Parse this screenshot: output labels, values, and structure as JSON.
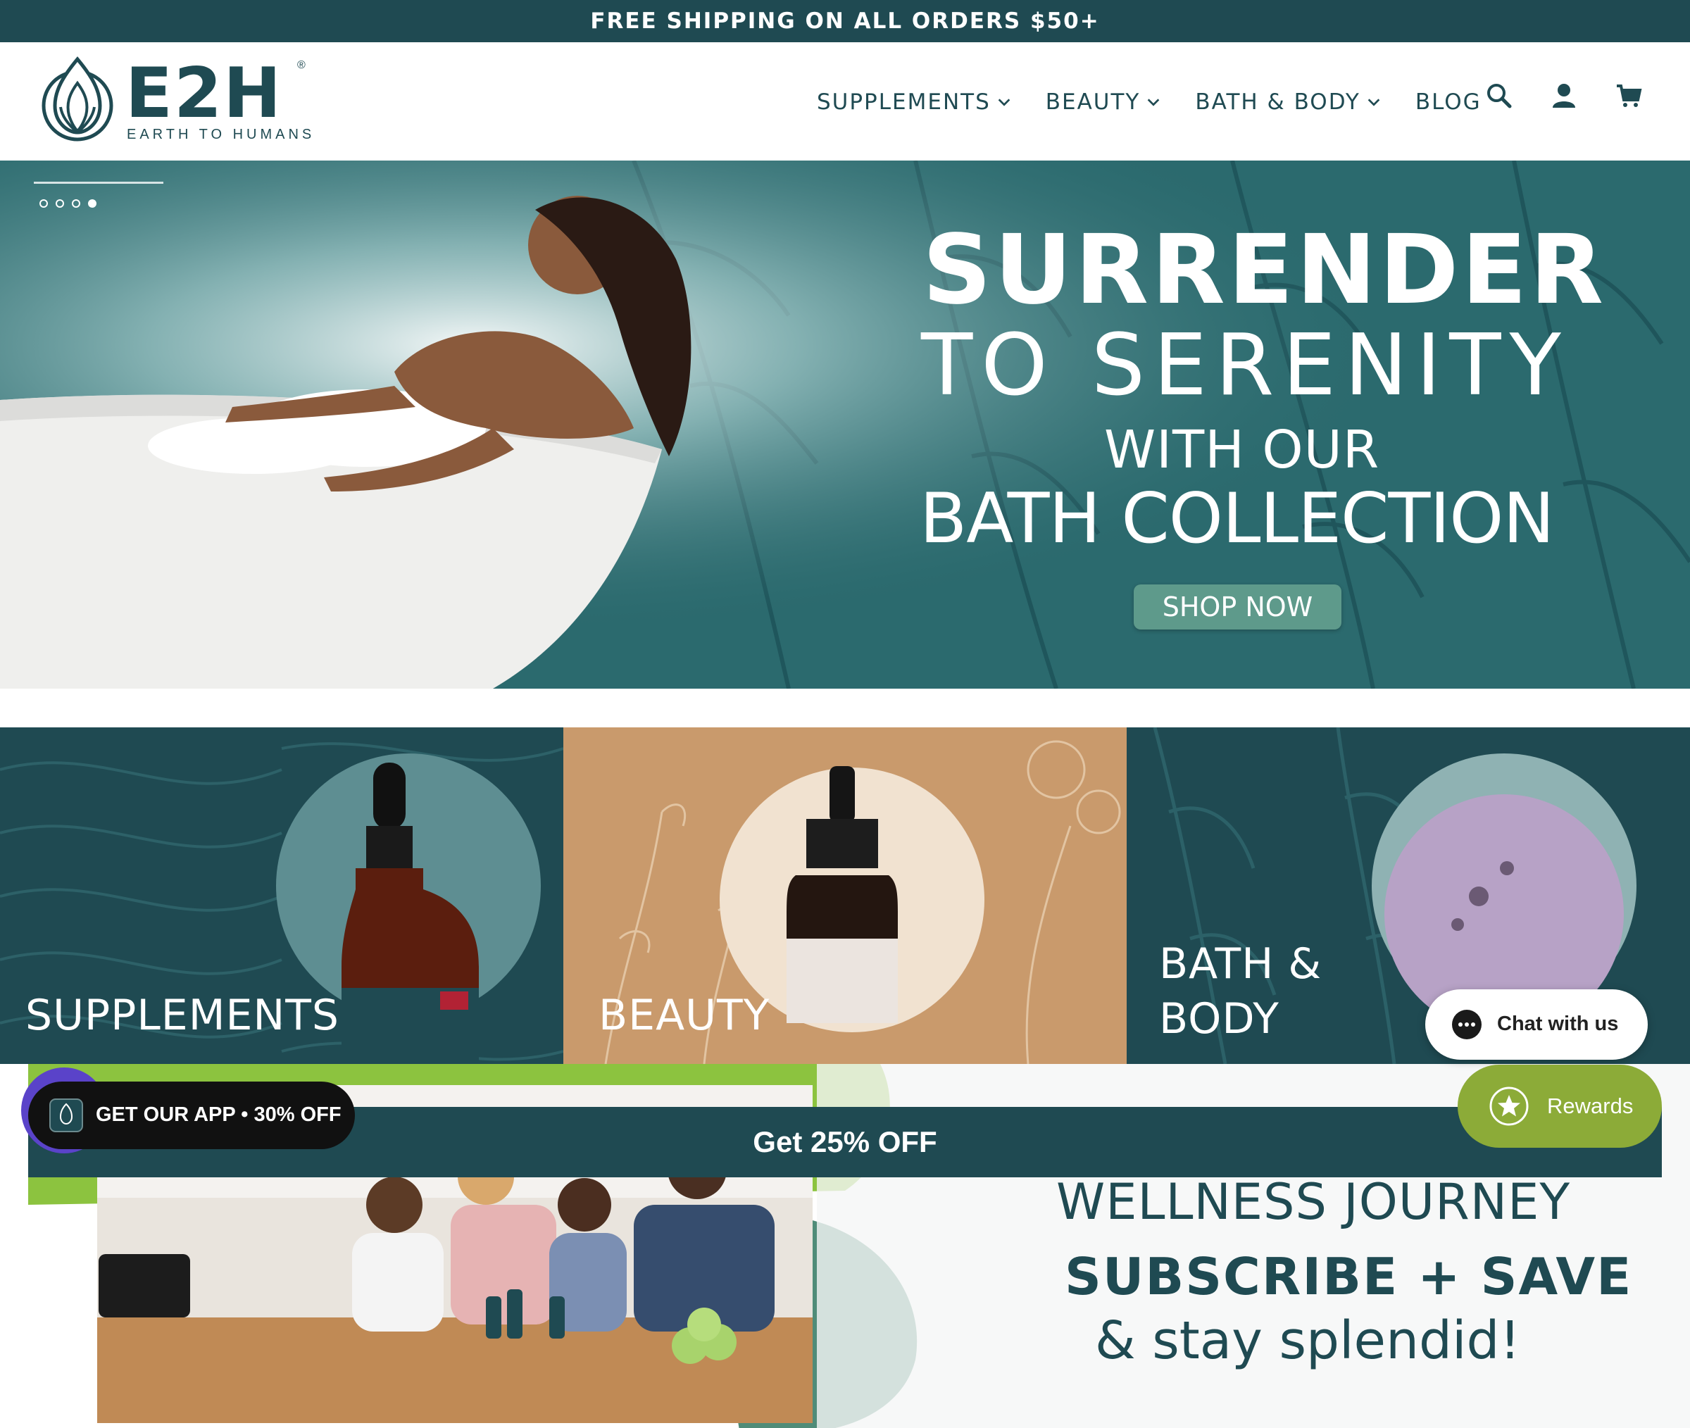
{
  "announcement": "FREE SHIPPING ON ALL ORDERS $50+",
  "brand": {
    "name": "E2H",
    "tagline": "EARTH TO HUMANS",
    "reg": "®"
  },
  "nav": {
    "items": [
      "SUPPLEMENTS",
      "BEAUTY",
      "BATH & BODY",
      "BLOG"
    ],
    "icons": [
      "search-icon",
      "account-icon",
      "cart-icon"
    ]
  },
  "hero": {
    "line1": "SURRENDER",
    "line2": "TO SERENITY",
    "line3": "WITH OUR",
    "line4": "BATH COLLECTION",
    "cta": "SHOP NOW",
    "slides": 4,
    "active_slide": 4
  },
  "categories": [
    {
      "label_1": "SUPPLEMENTS",
      "label_2": ""
    },
    {
      "label_1": "BEAUTY",
      "label_2": ""
    },
    {
      "label_1": "BATH &",
      "label_2": "BODY"
    }
  ],
  "promo": {
    "bar_text": "Get 25% OFF",
    "app_text": "GET OUR APP • 30% OFF",
    "chat_text": "Chat with us",
    "rewards_text": "Rewards"
  },
  "wellness": {
    "line1": "WELLNESS JOURNEY",
    "line2": "SUBSCRIBE + SAVE",
    "line3": "& stay splendid!"
  },
  "colors": {
    "brand_dark": "#1f4a52",
    "hero_teal": "#2b6a6e",
    "beauty_tan": "#c99a6c",
    "rewards_green": "#8cab38"
  }
}
